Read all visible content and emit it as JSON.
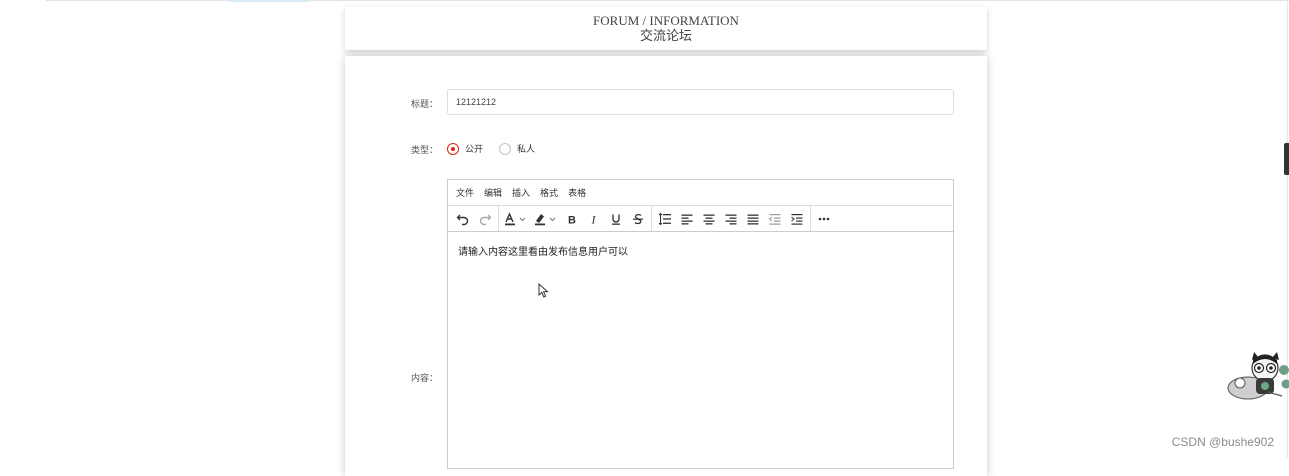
{
  "header": {
    "title_en": "FORUM / INFORMATION",
    "title_cn": "交流论坛"
  },
  "form": {
    "title_label": "标题：",
    "title_value": "12121212",
    "type_label": "类型：",
    "type_options": [
      {
        "label": "公开",
        "checked": true
      },
      {
        "label": "私人",
        "checked": false
      }
    ],
    "content_label": "内容："
  },
  "editor": {
    "menu": [
      "文件",
      "编辑",
      "插入",
      "格式",
      "表格"
    ],
    "toolbar_icons": [
      "undo-icon",
      "redo-icon",
      "font-color-icon",
      "highlight-color-icon",
      "bold-icon",
      "italic-icon",
      "underline-icon",
      "strikethrough-icon",
      "line-height-icon",
      "align-left-icon",
      "align-center-icon",
      "align-right-icon",
      "align-justify-icon",
      "outdent-icon",
      "indent-icon",
      "more-icon"
    ],
    "content": "请输入内容这里看由发布信息用户可以"
  },
  "colors": {
    "accent": "#e2231a",
    "border": "#dcdfe6"
  },
  "watermark": "CSDN @bushe902"
}
